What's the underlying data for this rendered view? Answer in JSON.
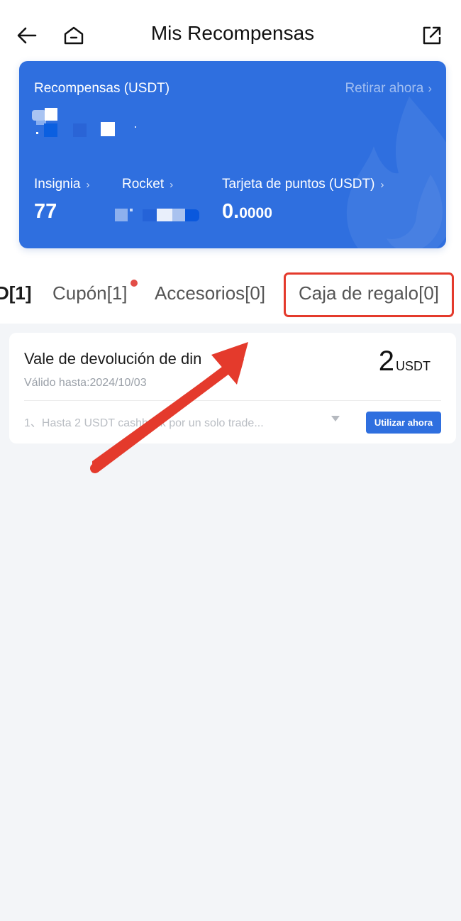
{
  "header": {
    "title": "Mis Recompensas",
    "back_icon": "arrow-left-icon",
    "home_icon": "home-icon",
    "share_icon": "external-share-icon"
  },
  "rewards_card": {
    "title": "Recompensas (USDT)",
    "withdraw_label": "Retirar ahora",
    "chevron": "›",
    "stats": {
      "insignia_label": "Insignia",
      "insignia_value": "77",
      "rocket_label": "Rocket",
      "points_card_label": "Tarjeta de puntos (USDT)",
      "points_card_int": "0.",
      "points_card_dec": "0000"
    },
    "accent_color": "#2f6fdf"
  },
  "tabs": [
    {
      "label": "D[1]"
    },
    {
      "label": "Cupón[1]"
    },
    {
      "label": "Accesorios[0]"
    },
    {
      "label": "Caja de regalo[0]"
    }
  ],
  "voucher": {
    "title": "Vale de devolución de din",
    "validity": "Válido hasta:2024/10/03",
    "amount": "2",
    "unit": "USDT",
    "description": "1、Hasta 2 USDT cashback por un solo trade...",
    "use_button": "Utilizar ahora"
  },
  "annotation": {
    "arrow_color": "#e43a2c"
  }
}
